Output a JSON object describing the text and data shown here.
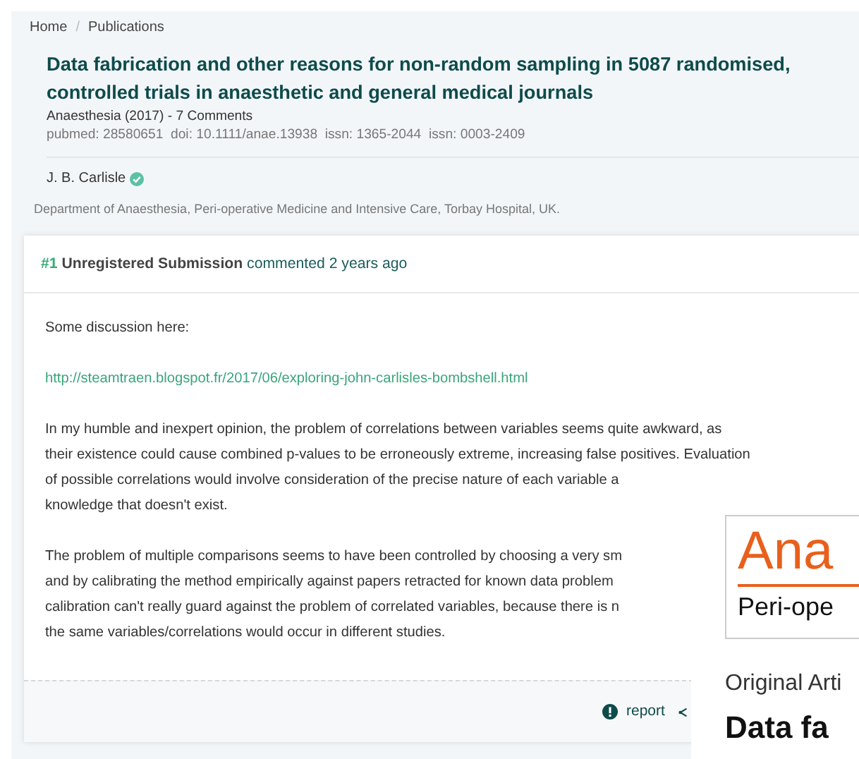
{
  "breadcrumb": [
    {
      "label": "Home"
    },
    {
      "label": "Publications"
    }
  ],
  "breadcrumb_separator": "/",
  "article": {
    "title": "Data fabrication and other reasons for non-random sampling in 5087 randomised, controlled trials in anaesthetic and general medical journals",
    "journal": "Anaesthesia (2017) - 7 Comments",
    "identifiers": "pubmed: 28580651  doi: 10.1111/anae.13938  issn: 1365-2044  issn: 0003-2409",
    "author": {
      "name": "J. B. Carlisle",
      "verified": true
    },
    "affiliation": "Department of Anaesthesia, Peri-operative Medicine and Intensive Care, Torbay Hospital, UK."
  },
  "comment": {
    "number": "#1",
    "author": "Unregistered Submission",
    "action": "commented 2 years ago",
    "paragraphs": [
      {
        "kind": "text",
        "lines": [
          "Some discussion here:"
        ]
      },
      {
        "kind": "link",
        "lines": [
          "http://steamtraen.blogspot.fr/2017/06/exploring-john-carlisles-bombshell.html"
        ]
      },
      {
        "kind": "text",
        "lines": [
          "In my humble and inexpert opinion, the problem of correlations between variables seems quite awkward, as",
          "their existence could cause combined p-values to be erroneously extreme, increasing false positives. Evaluation",
          "of possible correlations would involve consideration of the precise nature of each variable a",
          "knowledge that doesn't exist."
        ]
      },
      {
        "kind": "text",
        "lines": [
          "The problem of multiple comparisons seems to have been controlled by choosing a very sm",
          "and by calibrating the method empirically against papers retracted for known data problem",
          "calibration can't really guard against the problem of correlated variables, because there is n",
          "the same variables/correlations would occur in different studies."
        ]
      }
    ],
    "report": "report"
  },
  "overlay": {
    "logo_text": "Ana",
    "logo_subtext": "Peri-ope",
    "section": "Original Arti",
    "heading": "Data fa"
  }
}
